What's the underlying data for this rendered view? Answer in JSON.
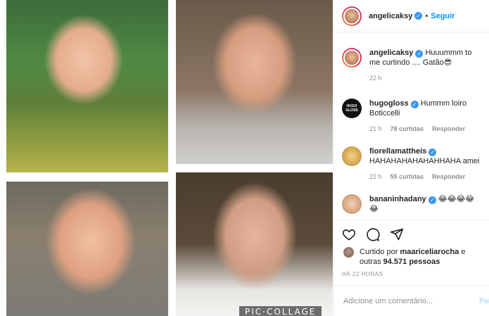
{
  "post": {
    "author": "angelicaksy",
    "follow_label": "Seguir",
    "separator": "•"
  },
  "comments": [
    {
      "user": "angelicaksy",
      "verified": true,
      "text": "Huuummm to me curtindo .... Gatão😎",
      "time": "22 h",
      "likes": "",
      "reply": ""
    },
    {
      "user": "hugogloss",
      "verified": true,
      "avatar_text": "HUGO GLOSS",
      "text": "Hummm loiro Boticcelli",
      "time": "21 h",
      "likes": "78 curtidas",
      "reply": "Responder"
    },
    {
      "user": "fiorellamattheis",
      "verified": true,
      "text": "HAHAHAHAHAHAHHAHA amei",
      "time": "22 h",
      "likes": "55 curtidas",
      "reply": "Responder"
    },
    {
      "user": "bananinhadany",
      "verified": true,
      "text": "😂😂😂😂😂",
      "time": "",
      "likes": "",
      "reply": ""
    }
  ],
  "actions": {
    "liked_by_prefix": "Curtido por",
    "liked_by_user": "maariceliarocha",
    "liked_by_suffix": "e outras",
    "liked_count": "94.571 pessoas",
    "timestamp": "HÁ 22 HORAS"
  },
  "add_comment": {
    "placeholder": "Adicione um comentário...",
    "publish_label": "Pu"
  },
  "media": {
    "watermark": "PIC·COLLAGE"
  }
}
